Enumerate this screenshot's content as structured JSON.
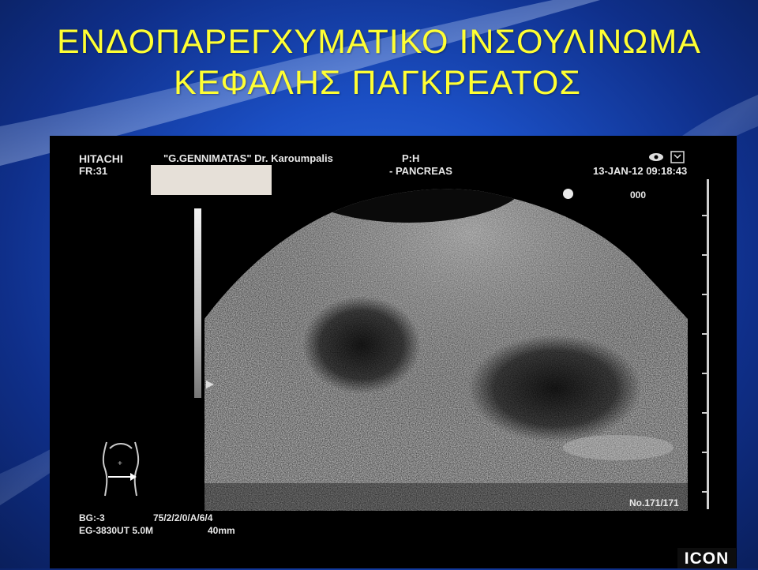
{
  "title": {
    "line1": "ΕΝΔΟΠΑΡΕΓΧΥΜΑΤΙΚΟ   ΙΝΣΟΥΛΙΝΩΜΑ",
    "line2": "ΚΕΦΑΛΗΣ  ΠΑΓΚΡΕΑΤΟΣ"
  },
  "ultrasound": {
    "brand": "HITACHI",
    "hospital": "\"G.GENNIMATAS\" Dr. Karoumpalis",
    "frame_rate": "FR:31",
    "probe_position": "P:H",
    "organ": "- PANCREAS",
    "datetime": "13-JAN-12  09:18:43",
    "code": "000",
    "frame_counter": "No.171/171",
    "params_bg": "BG:-3",
    "params_main": "75/2/2/0/A/6/4",
    "scope_model": "EG-3830UT  5.0M",
    "depth": "40mm",
    "logo": "ICON"
  },
  "colors": {
    "title": "#ffff33",
    "background": "#1b4fc4",
    "us_text": "#e8e8e8"
  }
}
